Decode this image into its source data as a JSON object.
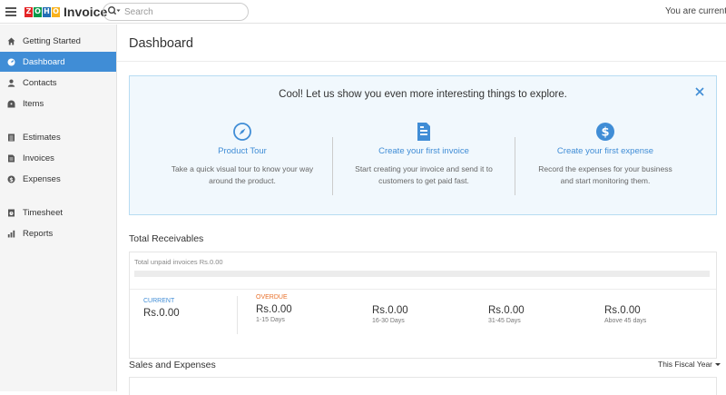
{
  "app": {
    "logo_letters": [
      "Z",
      "O",
      "H",
      "O"
    ],
    "logo_colors": [
      "#e42527",
      "#089949",
      "#226db4",
      "#f9b21d"
    ],
    "name": "Invoice"
  },
  "search": {
    "placeholder": "Search"
  },
  "topbar": {
    "right_text": "You are currently"
  },
  "sidebar": {
    "items": [
      {
        "label": "Getting Started",
        "icon": "home-icon"
      },
      {
        "label": "Dashboard",
        "icon": "dashboard-icon",
        "active": true
      },
      {
        "label": "Contacts",
        "icon": "person-icon"
      },
      {
        "label": "Items",
        "icon": "tag-icon"
      },
      {
        "label": "Estimates",
        "icon": "estimate-icon"
      },
      {
        "label": "Invoices",
        "icon": "invoice-icon"
      },
      {
        "label": "Expenses",
        "icon": "dollar-icon"
      },
      {
        "label": "Timesheet",
        "icon": "timesheet-icon"
      },
      {
        "label": "Reports",
        "icon": "bar-chart-icon"
      }
    ]
  },
  "main": {
    "title": "Dashboard",
    "banner": {
      "heading": "Cool! Let us show you even more interesting things to explore.",
      "features": [
        {
          "icon": "compass-icon",
          "title": "Product Tour",
          "desc_line1": "Take a quick visual tour to know your way",
          "desc_line2": "around the product."
        },
        {
          "icon": "invoice-doc-icon",
          "title": "Create your first invoice",
          "desc_line1": "Start creating your invoice and send it to",
          "desc_line2": "customers to get paid fast."
        },
        {
          "icon": "dollar-circle-icon",
          "title": "Create your first expense",
          "desc_line1": "Record the expenses for your business",
          "desc_line2": "and start monitoring them."
        }
      ]
    },
    "receivables": {
      "title": "Total Receivables",
      "unpaid_label": "Total unpaid invoices Rs.0.00",
      "current": {
        "label": "CURRENT",
        "amount": "Rs.0.00"
      },
      "overdue": {
        "label": "OVERDUE",
        "buckets": [
          {
            "amount": "Rs.0.00",
            "range": "1-15 Days"
          },
          {
            "amount": "Rs.0.00",
            "range": "16-30 Days"
          },
          {
            "amount": "Rs.0.00",
            "range": "31-45 Days"
          },
          {
            "amount": "Rs.0.00",
            "range": "Above 45 days"
          }
        ]
      }
    },
    "sales": {
      "title": "Sales and Expenses",
      "period": "This Fiscal Year"
    }
  },
  "colors": {
    "accent": "#408dd6",
    "overdue": "#e8702a",
    "current": "#408dd6",
    "banner_bg": "#f1f8fd"
  }
}
